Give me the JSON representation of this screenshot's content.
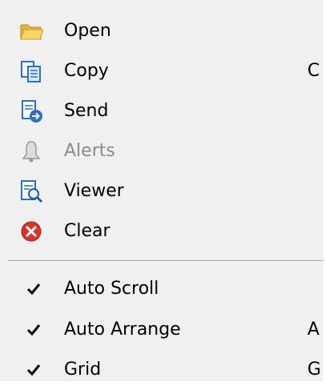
{
  "menu": {
    "items": [
      {
        "label": "Open",
        "icon": "folder-icon"
      },
      {
        "label": "Copy",
        "icon": "copy-icon",
        "shortcut": "C"
      },
      {
        "label": "Send",
        "icon": "send-icon"
      },
      {
        "label": "Alerts",
        "icon": "bell-icon",
        "disabled": true
      },
      {
        "label": "Viewer",
        "icon": "viewer-icon"
      },
      {
        "label": "Clear",
        "icon": "clear-icon"
      }
    ],
    "toggles": [
      {
        "label": "Auto Scroll",
        "checked": true
      },
      {
        "label": "Auto Arrange",
        "checked": true,
        "shortcut": "A"
      },
      {
        "label": "Grid",
        "checked": true,
        "shortcut": "G"
      }
    ]
  },
  "colors": {
    "menu_background": "#f0f0f0",
    "disabled_text": "#8a8a8a",
    "folder": "#f2c84b",
    "document_blue": "#2a6fc9",
    "clear_red": "#d9342b"
  }
}
